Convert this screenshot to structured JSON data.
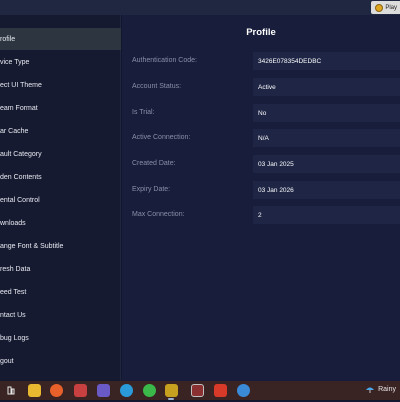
{
  "titlebar": {
    "app_label": "Play"
  },
  "sidebar": {
    "items": [
      {
        "label": "rofile",
        "active": true
      },
      {
        "label": "vice Type",
        "active": false
      },
      {
        "label": "ect UI Theme",
        "active": false
      },
      {
        "label": "eam Format",
        "active": false
      },
      {
        "label": "ar Cache",
        "active": false
      },
      {
        "label": "ault Category",
        "active": false
      },
      {
        "label": "den Contents",
        "active": false
      },
      {
        "label": "ental Control",
        "active": false
      },
      {
        "label": "wnloads",
        "active": false
      },
      {
        "label": "ange Font & Subtitle",
        "active": false
      },
      {
        "label": "resh Data",
        "active": false
      },
      {
        "label": "eed Test",
        "active": false
      },
      {
        "label": "ntact Us",
        "active": false
      },
      {
        "label": "bug Logs",
        "active": false
      },
      {
        "label": "gout",
        "active": false
      }
    ]
  },
  "main": {
    "title": "Profile",
    "rows": [
      {
        "label": "Authentication Code:",
        "value": "3426E078354DEDBC"
      },
      {
        "label": "Account Status:",
        "value": "Active"
      },
      {
        "label": "Is Trial:",
        "value": "No"
      },
      {
        "label": "Active Connection:",
        "value": "N/A"
      },
      {
        "label": "Created Date:",
        "value": "03 Jan 2025"
      },
      {
        "label": "Expiry Date:",
        "value": "03 Jan 2026"
      },
      {
        "label": "Max Connection:",
        "value": "2"
      }
    ]
  },
  "taskbar": {
    "icons": [
      {
        "name": "task-view-icon",
        "color": "#3a2323"
      },
      {
        "name": "file-explorer-icon",
        "color": "#e8b830"
      },
      {
        "name": "firefox-icon",
        "color": "#e8602a"
      },
      {
        "name": "media-player-icon",
        "color": "#c84040"
      },
      {
        "name": "app-icon-purple",
        "color": "#6a5ac8"
      },
      {
        "name": "edge-icon",
        "color": "#2a9ad8"
      },
      {
        "name": "android-app-icon",
        "color": "#3ab84a"
      },
      {
        "name": "iptv-player-icon",
        "color": "#c8a020"
      },
      {
        "name": "winrar-icon",
        "color": "#8a3030"
      },
      {
        "name": "app-icon-red",
        "color": "#d83a2a"
      },
      {
        "name": "paint-icon",
        "color": "#e87a9a"
      },
      {
        "name": "chrome-icon",
        "color": "#3a8ad8"
      }
    ],
    "weather_text": "Rainy"
  }
}
